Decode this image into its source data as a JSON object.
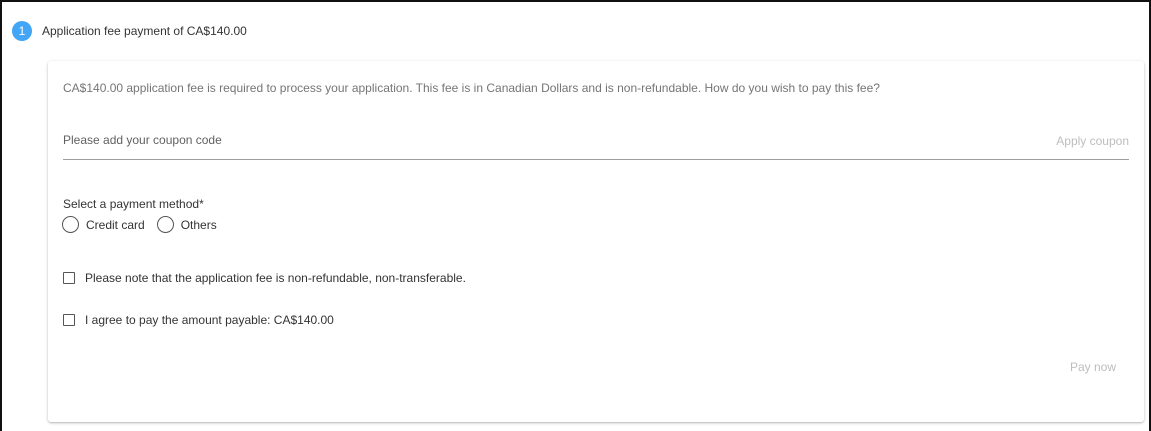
{
  "step": {
    "number": "1",
    "title": "Application fee payment of CA$140.00",
    "badge_color": "#42a5f5"
  },
  "card": {
    "description": "CA$140.00 application fee is required to process your application. This fee is in Canadian Dollars and is non-refundable. How do you wish to pay this fee?",
    "coupon": {
      "placeholder": "Please add your coupon code",
      "value": "",
      "apply_label": "Apply coupon"
    },
    "payment_method": {
      "label": "Select a payment method*",
      "options": [
        {
          "label": "Credit card",
          "selected": false
        },
        {
          "label": "Others",
          "selected": false
        }
      ]
    },
    "checkboxes": [
      {
        "label": "Please note that the application fee is non-refundable, non-transferable.",
        "checked": false
      },
      {
        "label": "I agree to pay the amount payable: CA$140.00",
        "checked": false
      }
    ],
    "pay_now_label": "Pay now"
  }
}
